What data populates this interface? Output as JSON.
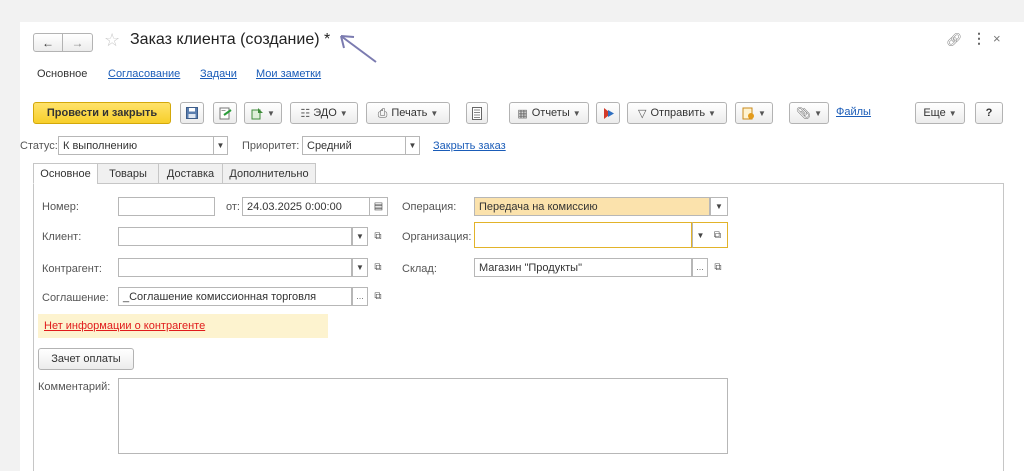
{
  "window": {
    "title": "Заказ клиента (создание) *"
  },
  "subtabs": [
    {
      "label": "Основное",
      "active": true
    },
    {
      "label": "Согласование",
      "active": false
    },
    {
      "label": "Задачи",
      "active": false
    },
    {
      "label": "Мои заметки",
      "active": false
    }
  ],
  "toolbar": {
    "post_close": "Провести и закрыть",
    "edo": "ЭДО",
    "print": "Печать",
    "reports": "Отчеты",
    "send": "Отправить",
    "files": "Файлы",
    "more": "Еще",
    "help": "?"
  },
  "statusbar": {
    "status_label": "Статус:",
    "status_value": "К выполнению",
    "priority_label": "Приоритет:",
    "priority_value": "Средний",
    "close_order": "Закрыть заказ"
  },
  "tabs": [
    "Основное",
    "Товары",
    "Доставка",
    "Дополнительно"
  ],
  "form": {
    "number_label": "Номер:",
    "number_value": "",
    "date_prefix": "от:",
    "date_value": "24.03.2025  0:00:00",
    "operation_label": "Операция:",
    "operation_value": "Передача на комиссию",
    "client_label": "Клиент:",
    "client_value": "",
    "org_label": "Организация:",
    "org_value": "",
    "counterparty_label": "Контрагент:",
    "counterparty_value": "",
    "warehouse_label": "Склад:",
    "warehouse_value": "Магазин \"Продукты\"",
    "agreement_label": "Соглашение:",
    "agreement_value": "_Соглашение комиссионная торговля",
    "warning": "Нет информации о контрагенте",
    "payment_offset": "Зачет оплаты",
    "comment_label": "Комментарий:",
    "comment_value": ""
  },
  "colors": {
    "primary": "#f7cf2a",
    "link": "#1a5cb8",
    "warning_bg": "#fdf3cf",
    "warning_text": "#e01b1b",
    "highlight_field": "#fbe2ac"
  }
}
